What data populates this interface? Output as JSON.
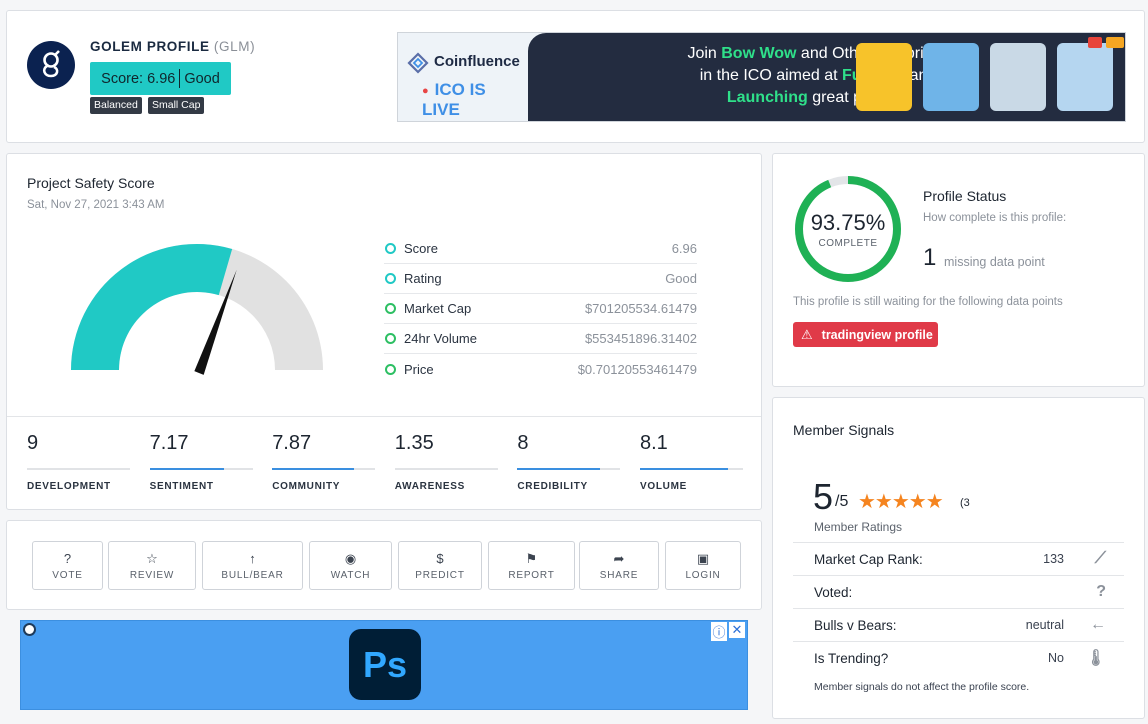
{
  "header": {
    "title": "GOLEM PROFILE",
    "symbol": "(GLM)",
    "score_text": "Score: 6.96",
    "rating_text": "Good",
    "tags": [
      "Balanced",
      "Small Cap"
    ]
  },
  "banner": {
    "brand": "Coinfluence",
    "live_text": "ICO IS LIVE",
    "line1_pre": "Join ",
    "line1_hl": "Bow Wow",
    "line1_post": " and Other celebrities",
    "line2_pre": "in the ICO aimed at ",
    "line2_hl": "Funding",
    "line2_post": " and",
    "line3_hl": "Launching",
    "line3_post": " great projects"
  },
  "safety": {
    "title": "Project Safety Score",
    "date": "Sat, Nov 27, 2021 3:43 AM",
    "gauge_score": 6.96,
    "gauge_max": 10,
    "metrics": [
      {
        "label": "Score",
        "value": "6.96",
        "color": "#20c9c5"
      },
      {
        "label": "Rating",
        "value": "Good",
        "color": "#20c9c5"
      },
      {
        "label": "Market Cap",
        "value": "$701205534.61479",
        "color": "#2dbf63"
      },
      {
        "label": "24hr Volume",
        "value": "$553451896.31402",
        "color": "#2dbf63"
      },
      {
        "label": "Price",
        "value": "$0.70120553461479",
        "color": "#2dbf63"
      }
    ],
    "subscores": [
      {
        "value": "9",
        "name": "DEVELOPMENT",
        "fill": 0
      },
      {
        "value": "7.17",
        "name": "SENTIMENT",
        "fill": 0.72
      },
      {
        "value": "7.87",
        "name": "COMMUNITY",
        "fill": 0.79
      },
      {
        "value": "1.35",
        "name": "AWARENESS",
        "fill": 0
      },
      {
        "value": "8",
        "name": "CREDIBILITY",
        "fill": 0.8
      },
      {
        "value": "8.1",
        "name": "VOLUME",
        "fill": 0.85
      }
    ]
  },
  "actions": [
    {
      "label": "VOTE",
      "icon": "?"
    },
    {
      "label": "REVIEW",
      "icon": "☆"
    },
    {
      "label": "BULL/BEAR",
      "icon": "↑"
    },
    {
      "label": "WATCH",
      "icon": "◉"
    },
    {
      "label": "PREDICT",
      "icon": "$"
    },
    {
      "label": "REPORT",
      "icon": "⚑"
    },
    {
      "label": "SHARE",
      "icon": "➦"
    },
    {
      "label": "LOGIN",
      "icon": "▣"
    }
  ],
  "ad": {
    "logo_text": "Ps",
    "info": "ⓘ",
    "close": "✕"
  },
  "status": {
    "percent": "93.75%",
    "percent_value": 93.75,
    "complete_label": "COMPLETE",
    "title": "Profile Status",
    "question": "How complete is this profile:",
    "missing_count": "1",
    "missing_label": "missing data point",
    "waiting": "This profile is still waiting for the following data points",
    "missing_item": "tradingview profile"
  },
  "signals": {
    "title": "Member Signals",
    "rating": "5",
    "rating_of": "/5",
    "stars": "★★★★★",
    "rating_count": "(3",
    "rating_label": "Member Ratings",
    "rows": [
      {
        "label": "Market Cap Rank:",
        "value": "133",
        "icon": "chart-icon"
      },
      {
        "label": "Voted:",
        "value": "",
        "icon": "question-icon"
      },
      {
        "label": "Bulls v Bears:",
        "value": "neutral",
        "icon": "arrow-left-icon"
      },
      {
        "label": "Is Trending?",
        "value": "No",
        "icon": "thermometer-icon"
      }
    ],
    "note": "Member signals do not affect the profile score."
  }
}
